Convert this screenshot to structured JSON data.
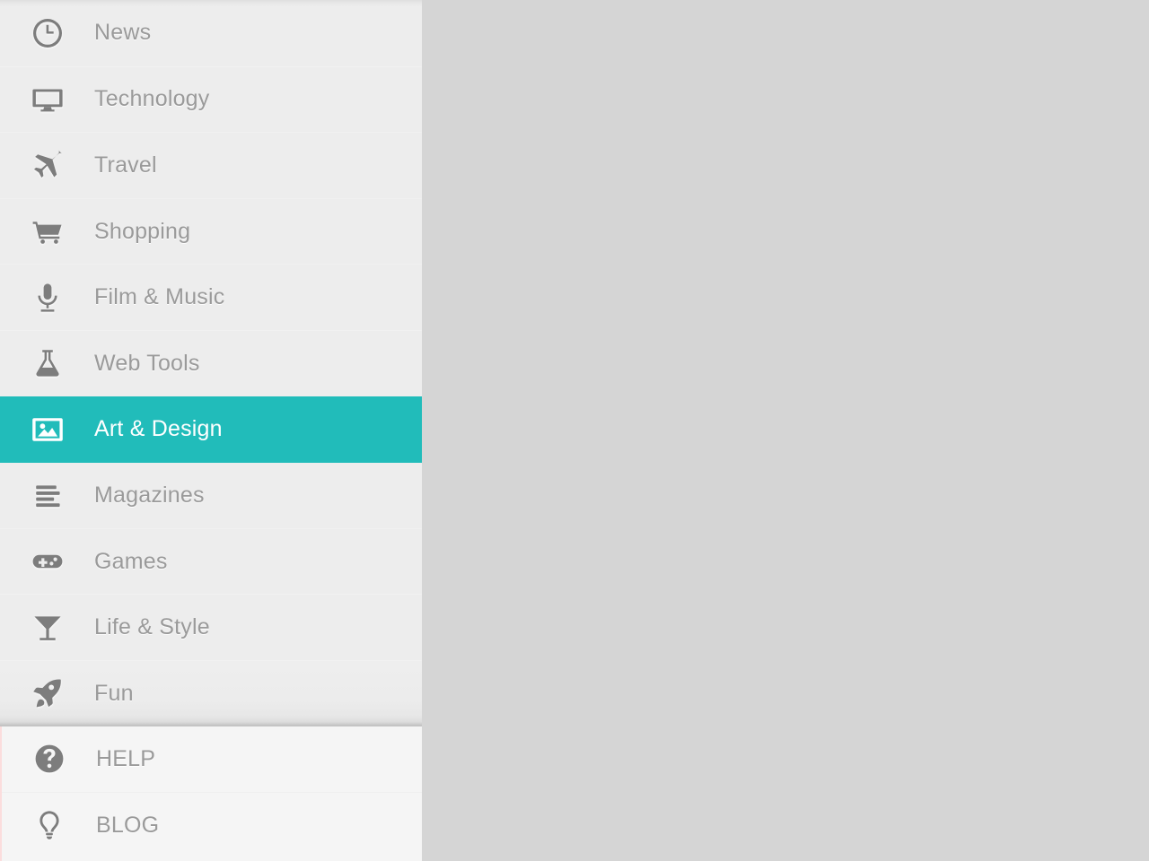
{
  "theme": {
    "sidebar_bg": "#ededed",
    "sidebar_footer_bg": "#f5f5f5",
    "content_bg": "#d5d5d5",
    "accent": "#21bcba",
    "label_color": "#9a9a9a",
    "icon_color": "#7d7d7d",
    "active_label_color": "#ffffff",
    "footer_accent_border": "#fbdddd"
  },
  "sidebar": {
    "primary_items": [
      {
        "label": "News",
        "icon": "clock-icon",
        "active": false
      },
      {
        "label": "Technology",
        "icon": "monitor-icon",
        "active": false
      },
      {
        "label": "Travel",
        "icon": "airplane-icon",
        "active": false
      },
      {
        "label": "Shopping",
        "icon": "cart-icon",
        "active": false
      },
      {
        "label": "Film & Music",
        "icon": "microphone-icon",
        "active": false
      },
      {
        "label": "Web Tools",
        "icon": "flask-icon",
        "active": false
      },
      {
        "label": "Art & Design",
        "icon": "image-icon",
        "active": true
      },
      {
        "label": "Magazines",
        "icon": "lines-icon",
        "active": false
      },
      {
        "label": "Games",
        "icon": "gamepad-icon",
        "active": false
      },
      {
        "label": "Life & Style",
        "icon": "cocktail-icon",
        "active": false
      },
      {
        "label": "Fun",
        "icon": "rocket-icon",
        "active": false
      }
    ],
    "secondary_items": [
      {
        "label": "HELP",
        "icon": "question-circle-icon"
      },
      {
        "label": "BLOG",
        "icon": "lightbulb-icon"
      }
    ]
  },
  "content": {
    "body_text": ""
  }
}
